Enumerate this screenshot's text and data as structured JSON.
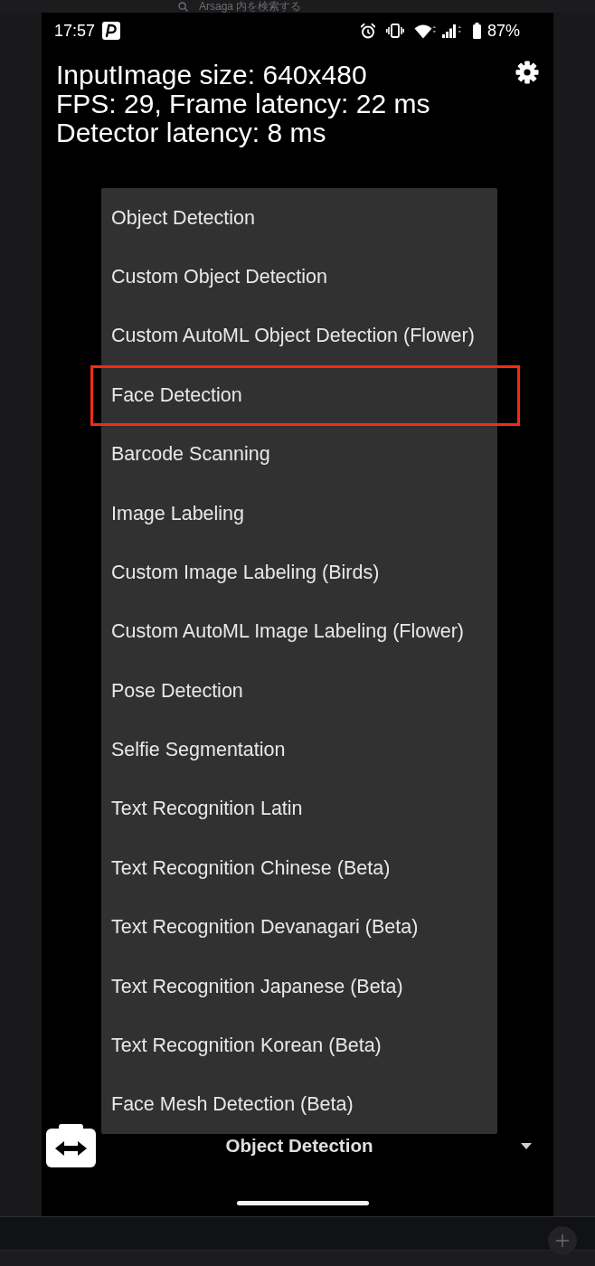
{
  "browser_search": {
    "placeholder": "Arsaga 内を検索する"
  },
  "status_bar": {
    "time": "17:57",
    "battery": "87%"
  },
  "stats": [
    "InputImage size: 640x480",
    "FPS: 29, Frame latency: 22 ms",
    "Detector latency: 8 ms"
  ],
  "menu_items": [
    {
      "label": "Object Detection",
      "highlighted": false
    },
    {
      "label": "Custom Object Detection",
      "highlighted": false
    },
    {
      "label": "Custom AutoML Object Detection (Flower)",
      "highlighted": false
    },
    {
      "label": "Face Detection",
      "highlighted": true
    },
    {
      "label": "Barcode Scanning",
      "highlighted": false
    },
    {
      "label": "Image Labeling",
      "highlighted": false
    },
    {
      "label": "Custom Image Labeling (Birds)",
      "highlighted": false
    },
    {
      "label": "Custom AutoML Image Labeling (Flower)",
      "highlighted": false
    },
    {
      "label": "Pose Detection",
      "highlighted": false
    },
    {
      "label": "Selfie Segmentation",
      "highlighted": false
    },
    {
      "label": "Text Recognition Latin",
      "highlighted": false
    },
    {
      "label": "Text Recognition Chinese (Beta)",
      "highlighted": false
    },
    {
      "label": "Text Recognition Devanagari (Beta)",
      "highlighted": false
    },
    {
      "label": "Text Recognition Japanese (Beta)",
      "highlighted": false
    },
    {
      "label": "Text Recognition Korean (Beta)",
      "highlighted": false
    },
    {
      "label": "Face Mesh Detection (Beta)",
      "highlighted": false
    }
  ],
  "spinner": {
    "value": "Object Detection"
  }
}
